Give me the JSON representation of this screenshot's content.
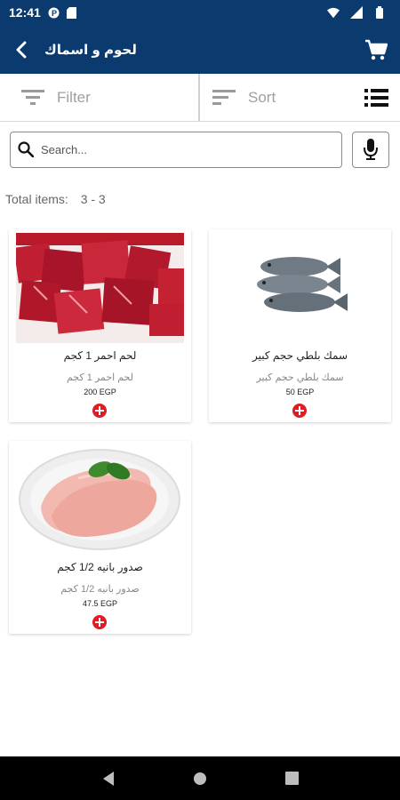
{
  "status_bar": {
    "time": "12:41"
  },
  "app_bar": {
    "title": "لحوم و اسماك"
  },
  "toolbar": {
    "filter_label": "Filter",
    "sort_label": "Sort"
  },
  "search": {
    "placeholder": "Search..."
  },
  "total": {
    "label": "Total items:",
    "value": "3 - 3"
  },
  "products": [
    {
      "name": "لحم احمر 1 كجم",
      "desc": "لحم احمر 1 كجم",
      "price": "200 EGP"
    },
    {
      "name": "سمك بلطي حجم كبير",
      "desc": "سمك بلطي حجم كبير",
      "price": "50 EGP"
    },
    {
      "name": "صدور بانيه 1/2 كجم",
      "desc": "صدور بانيه 1/2 كجم",
      "price": "47.5 EGP"
    }
  ],
  "colors": {
    "primary": "#0b3a6e",
    "accent": "#e01b24",
    "nav": "#000000"
  },
  "icons": [
    "back-arrow-icon",
    "cart-icon",
    "filter-icon",
    "sort-icon",
    "list-view-icon",
    "search-icon",
    "mic-icon",
    "add-icon"
  ]
}
